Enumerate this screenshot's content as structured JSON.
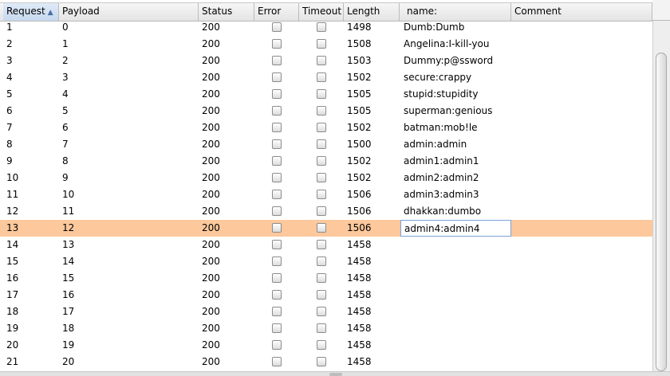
{
  "columns": [
    "Request",
    "Payload",
    "Status",
    "Error",
    "Timeout",
    "Length",
    "name:",
    "Comment"
  ],
  "sorted_column": "Request",
  "colors": {
    "selected_row": "#fcc89c",
    "header": "#e9e9e9",
    "sorted_header": "#cfdef0"
  },
  "rows": [
    {
      "request": "1",
      "payload": "0",
      "status": "200",
      "error": false,
      "timeout": false,
      "length": "1498",
      "name": "Dumb:Dumb",
      "comment": ""
    },
    {
      "request": "2",
      "payload": "1",
      "status": "200",
      "error": false,
      "timeout": false,
      "length": "1508",
      "name": "Angelina:I-kill-you",
      "comment": ""
    },
    {
      "request": "3",
      "payload": "2",
      "status": "200",
      "error": false,
      "timeout": false,
      "length": "1503",
      "name": "Dummy:p@ssword",
      "comment": ""
    },
    {
      "request": "4",
      "payload": "3",
      "status": "200",
      "error": false,
      "timeout": false,
      "length": "1502",
      "name": "secure:crappy",
      "comment": ""
    },
    {
      "request": "5",
      "payload": "4",
      "status": "200",
      "error": false,
      "timeout": false,
      "length": "1505",
      "name": "stupid:stupidity",
      "comment": ""
    },
    {
      "request": "6",
      "payload": "5",
      "status": "200",
      "error": false,
      "timeout": false,
      "length": "1505",
      "name": "superman:genious",
      "comment": ""
    },
    {
      "request": "7",
      "payload": "6",
      "status": "200",
      "error": false,
      "timeout": false,
      "length": "1502",
      "name": "batman:mob!le",
      "comment": ""
    },
    {
      "request": "8",
      "payload": "7",
      "status": "200",
      "error": false,
      "timeout": false,
      "length": "1500",
      "name": "admin:admin",
      "comment": ""
    },
    {
      "request": "9",
      "payload": "8",
      "status": "200",
      "error": false,
      "timeout": false,
      "length": "1502",
      "name": "admin1:admin1",
      "comment": ""
    },
    {
      "request": "10",
      "payload": "9",
      "status": "200",
      "error": false,
      "timeout": false,
      "length": "1502",
      "name": "admin2:admin2",
      "comment": ""
    },
    {
      "request": "11",
      "payload": "10",
      "status": "200",
      "error": false,
      "timeout": false,
      "length": "1506",
      "name": "admin3:admin3",
      "comment": ""
    },
    {
      "request": "12",
      "payload": "11",
      "status": "200",
      "error": false,
      "timeout": false,
      "length": "1506",
      "name": "dhakkan:dumbo",
      "comment": ""
    },
    {
      "request": "13",
      "payload": "12",
      "status": "200",
      "error": false,
      "timeout": false,
      "length": "1506",
      "name": "admin4:admin4",
      "comment": "",
      "selected": true
    },
    {
      "request": "14",
      "payload": "13",
      "status": "200",
      "error": false,
      "timeout": false,
      "length": "1458",
      "name": "",
      "comment": ""
    },
    {
      "request": "15",
      "payload": "14",
      "status": "200",
      "error": false,
      "timeout": false,
      "length": "1458",
      "name": "",
      "comment": ""
    },
    {
      "request": "16",
      "payload": "15",
      "status": "200",
      "error": false,
      "timeout": false,
      "length": "1458",
      "name": "",
      "comment": ""
    },
    {
      "request": "17",
      "payload": "16",
      "status": "200",
      "error": false,
      "timeout": false,
      "length": "1458",
      "name": "",
      "comment": ""
    },
    {
      "request": "18",
      "payload": "17",
      "status": "200",
      "error": false,
      "timeout": false,
      "length": "1458",
      "name": "",
      "comment": ""
    },
    {
      "request": "19",
      "payload": "18",
      "status": "200",
      "error": false,
      "timeout": false,
      "length": "1458",
      "name": "",
      "comment": ""
    },
    {
      "request": "20",
      "payload": "19",
      "status": "200",
      "error": false,
      "timeout": false,
      "length": "1458",
      "name": "",
      "comment": ""
    },
    {
      "request": "21",
      "payload": "20",
      "status": "200",
      "error": false,
      "timeout": false,
      "length": "1458",
      "name": "",
      "comment": ""
    }
  ]
}
